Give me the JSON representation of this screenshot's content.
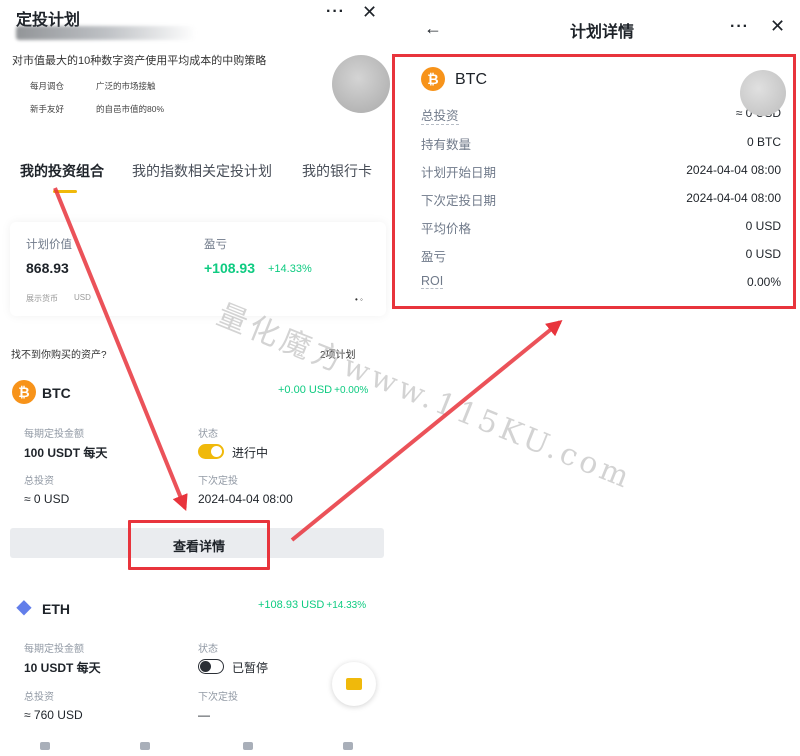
{
  "left": {
    "header": {
      "title": "定投计划",
      "more_icon": "···",
      "close_icon": "✕"
    },
    "strategy_text": "对市值最大的10种数字资产使用平均成本的中购策略",
    "features": [
      "每月调仓",
      "广泛的市场接触",
      "新手友好",
      "的自邑市值的80%"
    ],
    "tabs": [
      "我的投资组合",
      "我的指数相关定投计划",
      "我的银行卡"
    ],
    "summary": {
      "plan_value_label": "计划价值",
      "plan_value": "868.93",
      "pnl_label": "盈亏",
      "pnl_value": "+108.93",
      "pnl_pct": "+14.33%",
      "currency_label": "展示货币",
      "currency_value": "USD",
      "dots": "• ◦"
    },
    "not_found": "找不到你购买的资产?",
    "plan_count": "2项计划",
    "plans": [
      {
        "symbol": "BTC",
        "coin_glyph": "₿",
        "pnl": "+0.00 USD",
        "pnl_pct": "+0.00%",
        "amount_label": "每期定投金额",
        "amount": "100 USDT 每天",
        "status_label": "状态",
        "status": "进行中",
        "total_label": "总投资",
        "total": "≈ 0 USD",
        "next_label": "下次定投",
        "next": "2024-04-04 08:00",
        "details_button": "查看详情"
      },
      {
        "symbol": "ETH",
        "coin_glyph": "◆",
        "pnl": "+108.93 USD",
        "pnl_pct": "+14.33%",
        "amount_label": "每期定投金额",
        "amount": "10 USDT 每天",
        "status_label": "状态",
        "status": "已暂停",
        "total_label": "总投资",
        "total": "≈ 760 USD",
        "next_label": "下次定投",
        "next": "—"
      }
    ]
  },
  "right": {
    "header": {
      "back_icon": "←",
      "title": "计划详情",
      "more_icon": "···",
      "close_icon": "✕"
    },
    "coin": {
      "symbol": "BTC",
      "glyph": "₿"
    },
    "rows": [
      {
        "label": "总投资",
        "value": "≈ 0 USD"
      },
      {
        "label": "持有数量",
        "value": "0 BTC"
      },
      {
        "label": "计划开始日期",
        "value": "2024-04-04 08:00"
      },
      {
        "label": "下次定投日期",
        "value": "2024-04-04 08:00"
      },
      {
        "label": "平均价格",
        "value": "0 USD"
      },
      {
        "label": "盈亏",
        "value": "0 USD"
      },
      {
        "label": "ROI",
        "value": "0.00%"
      }
    ]
  },
  "watermark": "量化魔方www.115KU.com",
  "colors": {
    "accent": "#f0b90b",
    "profit": "#0ecb81",
    "annotation": "#e8343c",
    "btc": "#f7931a",
    "eth": "#627eea"
  }
}
